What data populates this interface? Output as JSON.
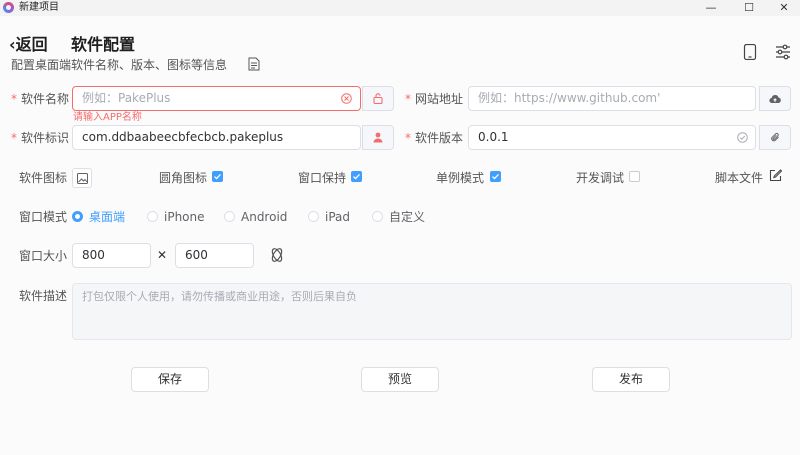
{
  "window": {
    "title": "新建项目",
    "minimize": "—",
    "maximize": "☐",
    "close": "✕"
  },
  "header": {
    "back_label": "返回",
    "title": "软件配置",
    "subtitle": "配置桌面端软件名称、版本、图标等信息"
  },
  "form": {
    "name": {
      "label": "软件名称",
      "placeholder": "例如：PakePlus",
      "error": "请输入APP名称"
    },
    "url": {
      "label": "网站地址",
      "placeholder": "例如：https://www.github.com'"
    },
    "id": {
      "label": "软件标识",
      "value": "com.ddbaabeecbfecbcb.pakeplus"
    },
    "version": {
      "label": "软件版本",
      "value": "0.0.1"
    },
    "icon_label": "软件图标",
    "rounded": {
      "label": "圆角图标",
      "checked": true
    },
    "keep_window": {
      "label": "窗口保持",
      "checked": true
    },
    "single": {
      "label": "单例模式",
      "checked": true
    },
    "devtools": {
      "label": "开发调试",
      "checked": false
    },
    "script_label": "脚本文件",
    "mode": {
      "label": "窗口模式",
      "options": [
        "桌面端",
        "iPhone",
        "Android",
        "iPad",
        "自定义"
      ],
      "selected": "桌面端"
    },
    "size": {
      "label": "窗口大小",
      "width": "800",
      "height": "600",
      "times": "✕"
    },
    "desc": {
      "label": "软件描述",
      "placeholder": "打包仅限个人使用，请勿传播或商业用途，否则后果自负"
    }
  },
  "actions": {
    "save": "保存",
    "preview": "预览",
    "publish": "发布"
  },
  "colors": {
    "accent": "#409eff",
    "error": "#f56c6c"
  }
}
